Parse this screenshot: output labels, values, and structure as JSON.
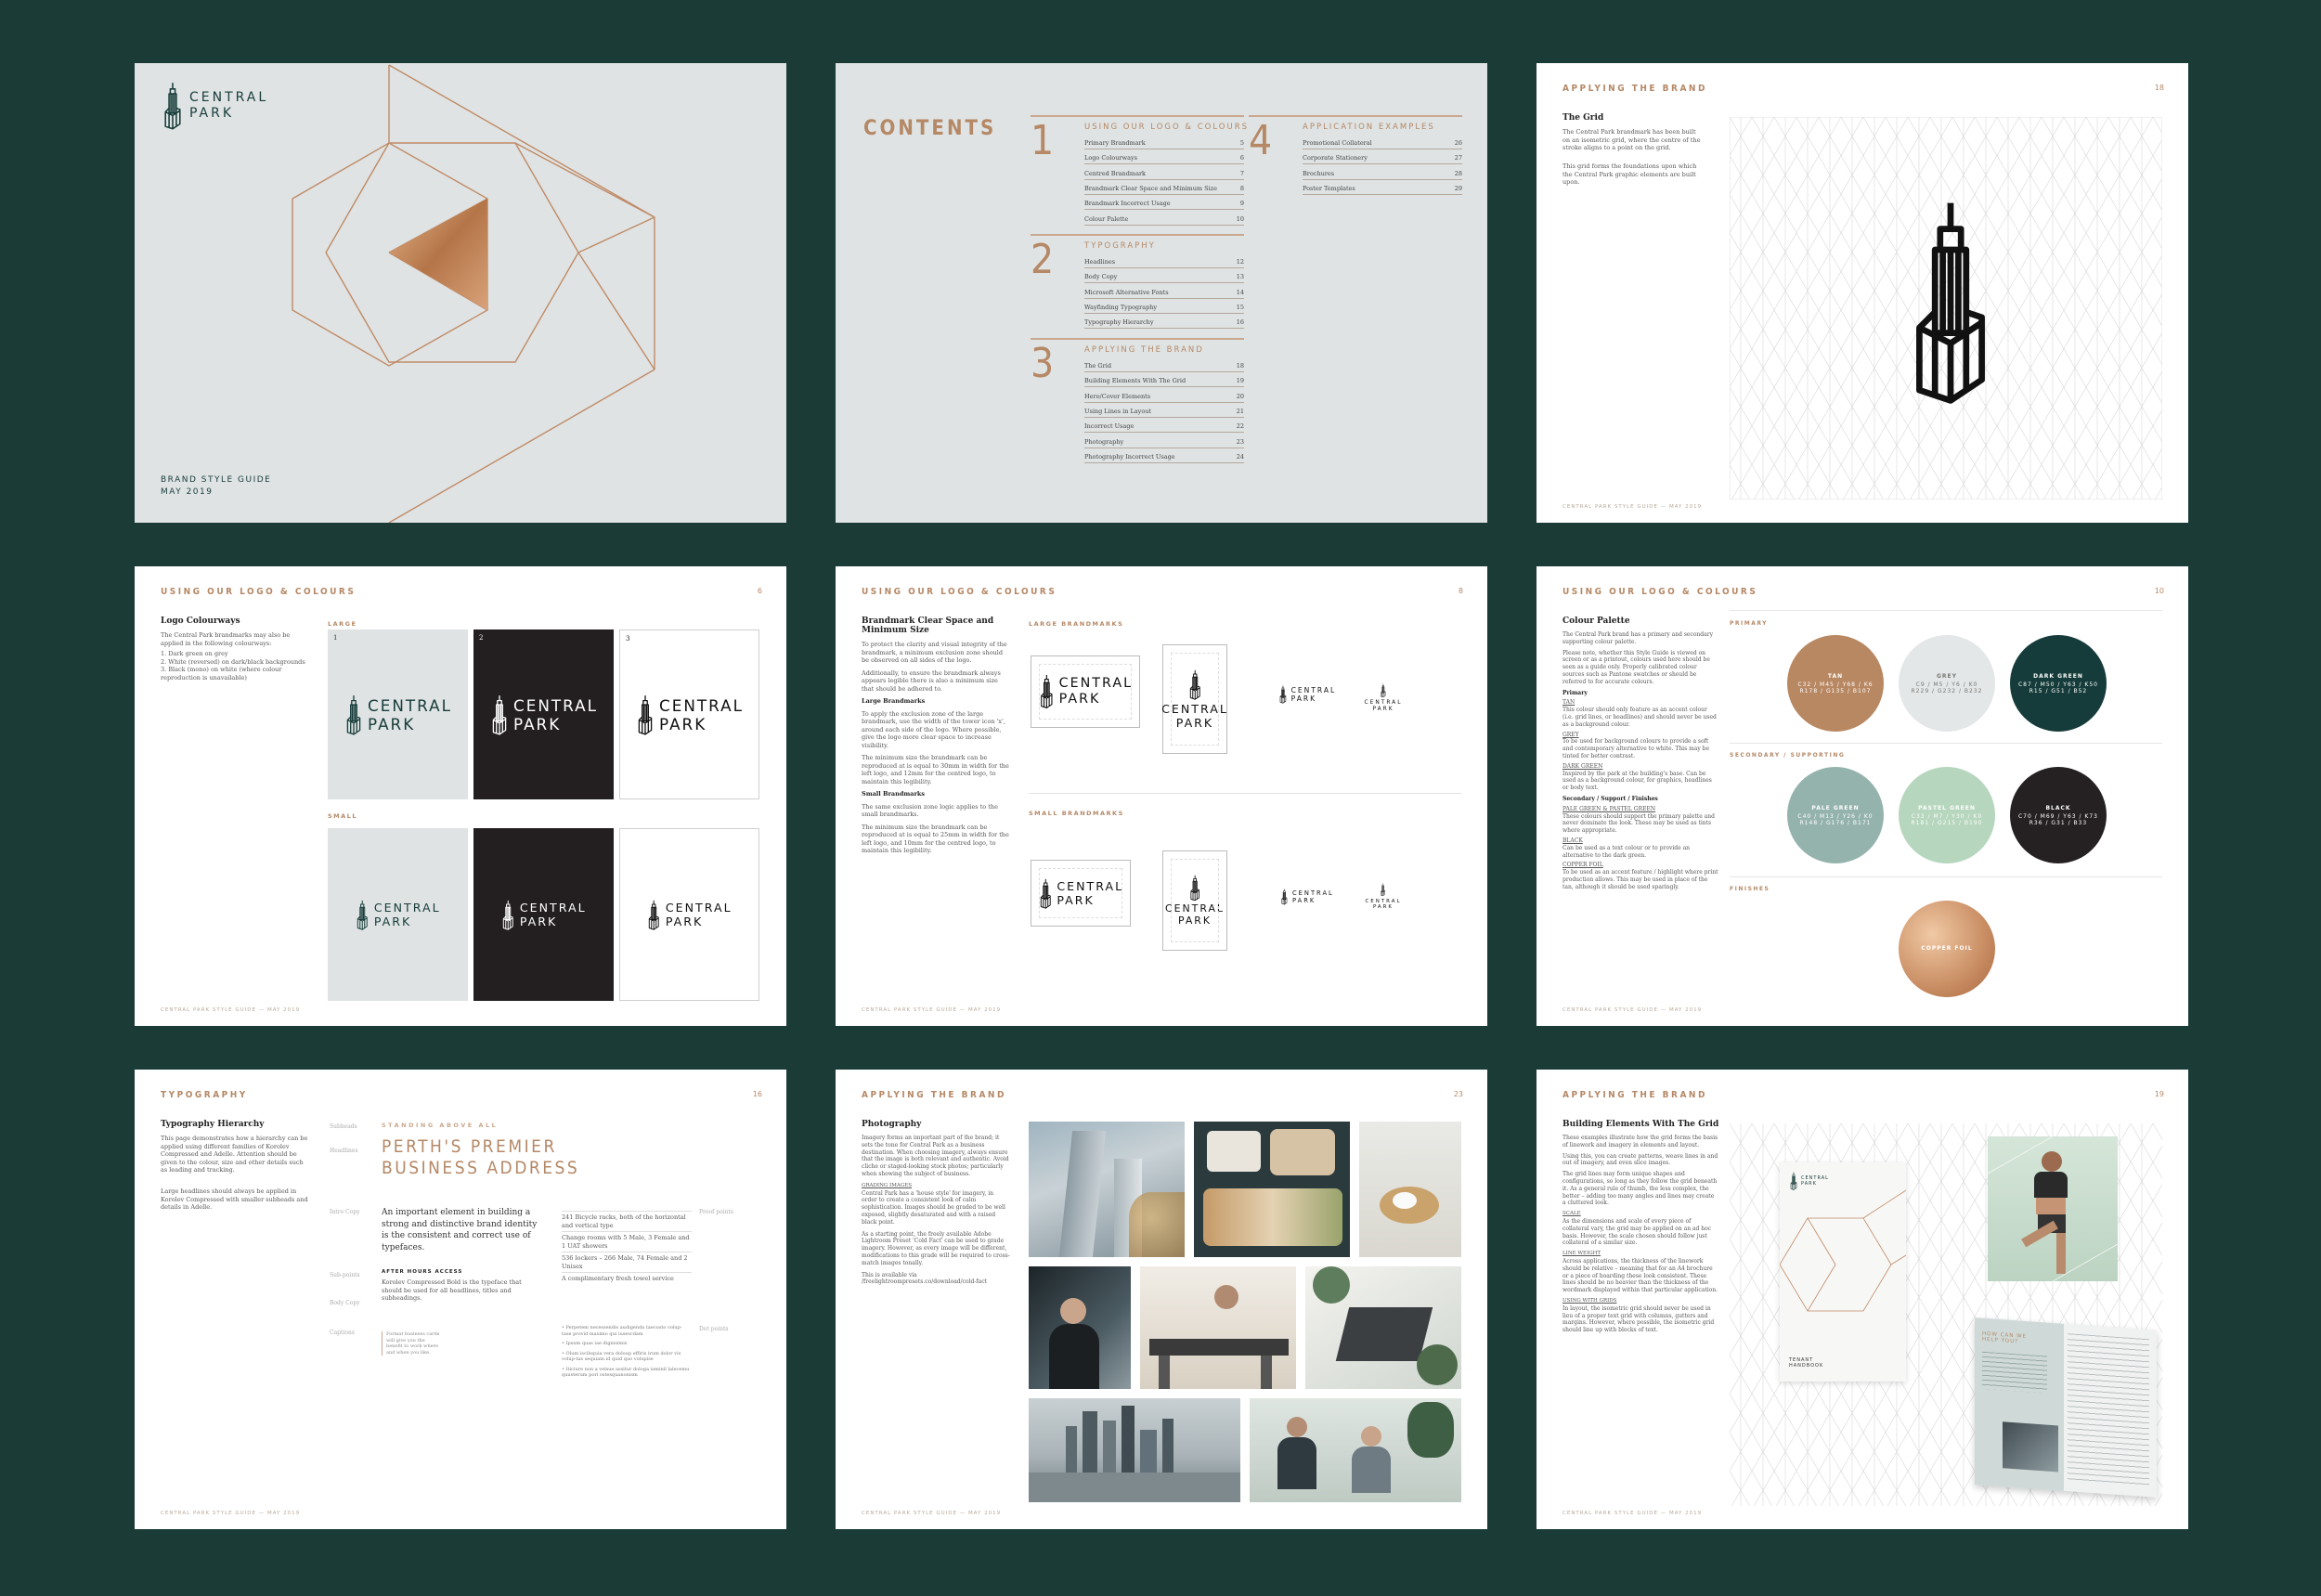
{
  "cover": {
    "logo": "CENTRAL PARK",
    "line1": "BRAND STYLE GUIDE",
    "line2": "MAY 2019",
    "accent": "#b58866"
  },
  "contents": {
    "title": "CONTENTS",
    "sections": [
      {
        "num": "1",
        "head": "USING OUR LOGO & COLOURS",
        "items": [
          {
            "t": "Primary Brandmark",
            "p": "5"
          },
          {
            "t": "Logo Colourways",
            "p": "6"
          },
          {
            "t": "Centred Brandmark",
            "p": "7"
          },
          {
            "t": "Brandmark Clear Space and Minimum Size",
            "p": "8"
          },
          {
            "t": "Brandmark Incorrect Usage",
            "p": "9"
          },
          {
            "t": "Colour Palette",
            "p": "10"
          }
        ]
      },
      {
        "num": "2",
        "head": "TYPOGRAPHY",
        "items": [
          {
            "t": "Headlines",
            "p": "12"
          },
          {
            "t": "Body Copy",
            "p": "13"
          },
          {
            "t": "Microsoft Alternative Fonts",
            "p": "14"
          },
          {
            "t": "Wayfinding Typography",
            "p": "15"
          },
          {
            "t": "Typography Hierarchy",
            "p": "16"
          }
        ]
      },
      {
        "num": "3",
        "head": "APPLYING THE BRAND",
        "items": [
          {
            "t": "The Grid",
            "p": "18"
          },
          {
            "t": "Building Elements With The Grid",
            "p": "19"
          },
          {
            "t": "Hero/Cover Elements",
            "p": "20"
          },
          {
            "t": "Using Lines in Layout",
            "p": "21"
          },
          {
            "t": "Incorrect Usage",
            "p": "22"
          },
          {
            "t": "Photography",
            "p": "23"
          },
          {
            "t": "Photography Incorrect Usage",
            "p": "24"
          }
        ]
      },
      {
        "num": "4",
        "head": "APPLICATION EXAMPLES",
        "items": [
          {
            "t": "Promotional Collateral",
            "p": "26"
          },
          {
            "t": "Corporate Stationery",
            "p": "27"
          },
          {
            "t": "Brochures",
            "p": "28"
          },
          {
            "t": "Poster Templates",
            "p": "29"
          }
        ]
      }
    ]
  },
  "grid_page": {
    "header": "APPLYING THE BRAND",
    "page": "18",
    "title": "The Grid",
    "p1": "The Central Park brandmark has been built on an isometric grid, where the centre of the stroke aligns to a point on the grid.",
    "p2": "This grid forms the foundations upon which the Central Park graphic elements are built upon.",
    "footer": "CENTRAL PARK STYLE GUIDE — MAY 2019"
  },
  "colourways": {
    "header": "USING OUR LOGO & COLOURS",
    "page": "6",
    "title": "Logo Colourways",
    "intro": "The Central Park brandmarks may also be applied in the following colourways:",
    "list": [
      "1.  Dark green on grey",
      "2.  White (reversed) on dark/black backgrounds",
      "3.  Black (mono) on white (where colour reproduction is unavailable)"
    ],
    "large": "LARGE",
    "small": "SMALL",
    "tile_nums": [
      "1",
      "2",
      "3"
    ],
    "logo_l1": "CENTRAL",
    "logo_l2": "PARK",
    "footer": "CENTRAL PARK STYLE GUIDE — MAY 2019"
  },
  "clearspace": {
    "header": "USING OUR LOGO & COLOURS",
    "page": "8",
    "title": "Brandmark Clear Space and Minimum Size",
    "p1": "To protect the clarity and visual integrity of the brandmark, a minimum exclusion zone should be observed on all sides of the logo.",
    "p2": "Additionally, to ensure the brandmark always appears legible there is also a minimum size that should be adhered to.",
    "sub1": "Large Brandmarks",
    "p3": "To apply the exclusion zone of the large brandmark, use the width of the tower icon 'x', around each side of the logo. Where possible, give the logo more clear space to increase visibility.",
    "p4": "The minimum size the brandmark can be reproduced at is equal to 30mm in width for the left logo, and 12mm for the centred logo, to maintain this legibility.",
    "sub2": "Small Brandmarks",
    "p5": "The same exclusion zone logic applies to the small brandmarks.",
    "p6": "The minimum size the brandmark can be reproduced at is equal to 25mm in width for the left logo, and 10mm for the centred logo, to maintain this legibility.",
    "large": "LARGE BRANDMARKS",
    "small": "SMALL BRANDMARKS",
    "logo_l1": "CENTRAL",
    "logo_l2": "PARK",
    "footer": "CENTRAL PARK STYLE GUIDE — MAY 2019"
  },
  "palette": {
    "header": "USING OUR LOGO & COLOURS",
    "page": "10",
    "title": "Colour Palette",
    "p1": "The Central Park brand has a primary and secondary supporting colour palette.",
    "p2": "Please note, whether this Style Guide is viewed on screen or as a printout, colours used here should be seen as a guide only. Properly calibrated colour sources such as Pantone swatches or should be referred to for accurate colours.",
    "primary_head": "Primary",
    "tan_h": "TAN",
    "tan_t": "This colour should only feature as an accent colour (i.e. grid lines, or headlines) and should never be used as a background colour.",
    "grey_h": "GREY",
    "grey_t": "To be used for background colours to provide a soft and contemporary alternative to white. This may be tinted for better contrast.",
    "dg_h": "DARK GREEN",
    "dg_t": "Inspired by the park at the building's base. Can be used as a background colour, for graphics, headlines or body text.",
    "secondary_head": "Secondary / Support / Finishes",
    "pg_h": "PALE GREEN & PASTEL GREEN",
    "pg_t": "These colours should support the primary palette and never dominate the look. These may be used as tints where appropriate.",
    "bl_h": "BLACK",
    "bl_t": "Can be used as a text colour or to provide an alternative to the dark green.",
    "cf_h": "COPPER FOIL",
    "cf_t": "To be used as an accent feature / highlight where print production allows. This may be used in place of the tan, although it should be used sparingly.",
    "lbl_primary": "PRIMARY",
    "lbl_secondary": "SECONDARY / SUPPORTING",
    "lbl_finishes": "FINISHES",
    "swatches": [
      {
        "name": "TAN",
        "v1": "C32 / M45 / Y68 / K6",
        "v2": "R178 / G135 / B107",
        "color": "#b88862"
      },
      {
        "name": "GREY",
        "v1": "C9 / M5 / Y6 / K0",
        "v2": "R229 / G232 / B232",
        "color": "#e4e7e7"
      },
      {
        "name": "DARK GREEN",
        "v1": "C87 / M50 / Y63 / K50",
        "v2": "R15 / G51 / B52",
        "color": "#153c3a"
      },
      {
        "name": "PALE GREEN",
        "v1": "C40 / M13 / Y26 / K0",
        "v2": "R148 / G176 / B171",
        "color": "#95b3ad"
      },
      {
        "name": "PASTEL GREEN",
        "v1": "C33 / M7 / Y30 / K0",
        "v2": "R181 / G215 / B190",
        "color": "#b6d6bd"
      },
      {
        "name": "BLACK",
        "v1": "C70 / M69 / Y63 / K73",
        "v2": "R36 / G31 / B33",
        "color": "#252022"
      },
      {
        "name": "COPPER FOIL",
        "v1": "",
        "v2": "",
        "color": "#c98d63"
      }
    ],
    "footer": "CENTRAL PARK STYLE GUIDE — MAY 2019"
  },
  "typography": {
    "header": "TYPOGRAPHY",
    "page": "16",
    "title": "Typography Hierarchy",
    "p1": "This page demonstrates how a hierarchy can be applied using different families of Korolev Compressed and Adelle. Attention should be given to the colour, size and other details such as leading and tracking.",
    "p2": "Large headlines should always be applied in Korolev Compressed with smaller subheads and details in Adelle.",
    "labels": [
      "Subheads",
      "Headlines",
      "Intro Copy",
      "Sub-points",
      "Body Copy",
      "Captions"
    ],
    "subhead": "STANDING ABOVE ALL",
    "headline1": "PERTH'S PREMIER",
    "headline2": "BUSINESS ADDRESS",
    "intro": "An important element in building a strong and distinctive brand identity is the consistent and correct use of typefaces.",
    "subpoint": "AFTER HOURS ACCESS",
    "body": "Korolev Compressed Bold is the typeface that should be used for all headlines, titles and subheadings.",
    "caption": "Format business cards will give you the benefit to work where and when you like.",
    "list": [
      "241 Bicycle racks, both of the horizontal and vertical type",
      "Change rooms with 5 Male, 3 Female and 1 UAT showers",
      "536 lockers – 266 Male, 74 Female and 2 Unisex",
      "A complimentary fresh towel service"
    ],
    "dots": [
      "Perpetem necessendis audigenda taecusto volup-tase provid maximo qui iusescdam",
      "Ipsum quas iae dignisimis",
      "Olum iscilsquia vera doloup effiris irum dolor vis volup-tas sequiam id quid quo volupise",
      "Iticiure non a velsue assitur dologa iaminil lalecemu quusterum pori ostesquanonism"
    ],
    "right_labels": [
      "Proof points",
      "Dot points"
    ],
    "footer": "CENTRAL PARK STYLE GUIDE — MAY 2019"
  },
  "photography": {
    "header": "APPLYING THE BRAND",
    "page": "23",
    "title": "Photography",
    "p1": "Imagery forms an important part of the brand; it sets the tone for Central Park as a business destination. When choosing imagery, always ensure that the image is both relevant and authentic. Avoid cliche or staged-looking stock photos; particularly when showing the subject of business.",
    "sub": "GRADING IMAGES",
    "p2": "Central Park has a 'house style' for imagery, in order to create a consistent look of calm sophistication. Images should be graded to be well exposed, slightly desaturated and with a raised black point.",
    "p3": "As a starting point, the freely available Adobe Lightroom Preset 'Cold Fact' can be used to grade imagery. However, as every image will be different, modifications to this grade will be required to cross-match images tonally.",
    "p4": "This is available via /freelightroompresets.co/download/cold-fact",
    "footer": "CENTRAL PARK STYLE GUIDE — MAY 2019"
  },
  "building": {
    "header": "APPLYING THE BRAND",
    "page": "19",
    "title": "Building Elements With The Grid",
    "p1": "These examples illustrate how the grid forms the basis of linework and imagery in elements and layout.",
    "p2": "Using this, you can create patterns, weave lines in and out of imagery, and even slice images.",
    "p3": "The grid lines may form unique shapes and configurations, so long as they follow the grid beneath it. As a general rule of thumb, the less complex, the better – adding too many angles and lines may create a cluttered look.",
    "s1": "SCALE",
    "p4": "As the dimensions and scale of every piece of collateral vary, the grid may be applied on an ad hoc basis. However, the scale chosen should follow just collateral of a similar size.",
    "s2": "LINE WEIGHT",
    "p5": "Across applications, the thickness of the linework should be relative – meaning that for an A4 brochure or a piece of hoarding these look consistent. These lines should be no heavier than the thickness of the wordmark displayed within that particular application.",
    "s3": "USING WITH GRIDS",
    "p6": "In layout, the isometric grid should never be used in lieu of a proper text grid with columns, gutters and margins. However, where possible, the isometric grid should line up with blocks of text.",
    "brochure_logo": "CENTRAL PARK",
    "brochure_text": "TENANT HANDBOOK",
    "mag_head": "HOW CAN WE HELP YOU?",
    "footer": "CENTRAL PARK STYLE GUIDE — MAY 2019"
  }
}
